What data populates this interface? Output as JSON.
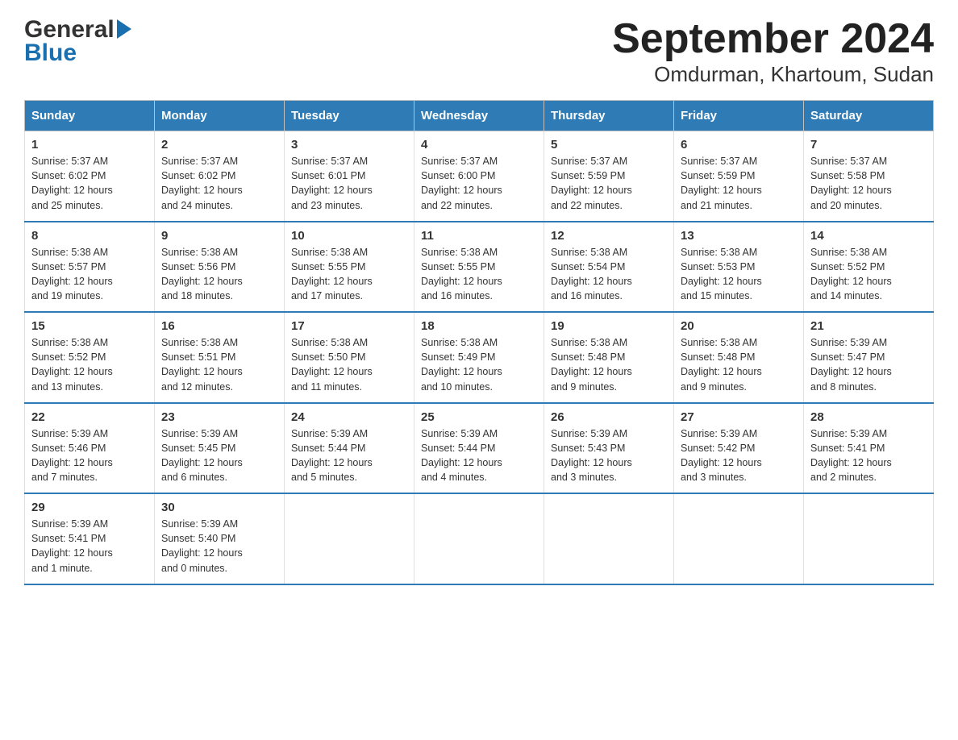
{
  "logo": {
    "part1": "General",
    "part2": "Blue"
  },
  "title": {
    "month_year": "September 2024",
    "location": "Omdurman, Khartoum, Sudan"
  },
  "days_of_week": [
    "Sunday",
    "Monday",
    "Tuesday",
    "Wednesday",
    "Thursday",
    "Friday",
    "Saturday"
  ],
  "weeks": [
    [
      {
        "day": "1",
        "sunrise": "5:37 AM",
        "sunset": "6:02 PM",
        "daylight": "12 hours and 25 minutes."
      },
      {
        "day": "2",
        "sunrise": "5:37 AM",
        "sunset": "6:02 PM",
        "daylight": "12 hours and 24 minutes."
      },
      {
        "day": "3",
        "sunrise": "5:37 AM",
        "sunset": "6:01 PM",
        "daylight": "12 hours and 23 minutes."
      },
      {
        "day": "4",
        "sunrise": "5:37 AM",
        "sunset": "6:00 PM",
        "daylight": "12 hours and 22 minutes."
      },
      {
        "day": "5",
        "sunrise": "5:37 AM",
        "sunset": "5:59 PM",
        "daylight": "12 hours and 22 minutes."
      },
      {
        "day": "6",
        "sunrise": "5:37 AM",
        "sunset": "5:59 PM",
        "daylight": "12 hours and 21 minutes."
      },
      {
        "day": "7",
        "sunrise": "5:37 AM",
        "sunset": "5:58 PM",
        "daylight": "12 hours and 20 minutes."
      }
    ],
    [
      {
        "day": "8",
        "sunrise": "5:38 AM",
        "sunset": "5:57 PM",
        "daylight": "12 hours and 19 minutes."
      },
      {
        "day": "9",
        "sunrise": "5:38 AM",
        "sunset": "5:56 PM",
        "daylight": "12 hours and 18 minutes."
      },
      {
        "day": "10",
        "sunrise": "5:38 AM",
        "sunset": "5:55 PM",
        "daylight": "12 hours and 17 minutes."
      },
      {
        "day": "11",
        "sunrise": "5:38 AM",
        "sunset": "5:55 PM",
        "daylight": "12 hours and 16 minutes."
      },
      {
        "day": "12",
        "sunrise": "5:38 AM",
        "sunset": "5:54 PM",
        "daylight": "12 hours and 16 minutes."
      },
      {
        "day": "13",
        "sunrise": "5:38 AM",
        "sunset": "5:53 PM",
        "daylight": "12 hours and 15 minutes."
      },
      {
        "day": "14",
        "sunrise": "5:38 AM",
        "sunset": "5:52 PM",
        "daylight": "12 hours and 14 minutes."
      }
    ],
    [
      {
        "day": "15",
        "sunrise": "5:38 AM",
        "sunset": "5:52 PM",
        "daylight": "12 hours and 13 minutes."
      },
      {
        "day": "16",
        "sunrise": "5:38 AM",
        "sunset": "5:51 PM",
        "daylight": "12 hours and 12 minutes."
      },
      {
        "day": "17",
        "sunrise": "5:38 AM",
        "sunset": "5:50 PM",
        "daylight": "12 hours and 11 minutes."
      },
      {
        "day": "18",
        "sunrise": "5:38 AM",
        "sunset": "5:49 PM",
        "daylight": "12 hours and 10 minutes."
      },
      {
        "day": "19",
        "sunrise": "5:38 AM",
        "sunset": "5:48 PM",
        "daylight": "12 hours and 9 minutes."
      },
      {
        "day": "20",
        "sunrise": "5:38 AM",
        "sunset": "5:48 PM",
        "daylight": "12 hours and 9 minutes."
      },
      {
        "day": "21",
        "sunrise": "5:39 AM",
        "sunset": "5:47 PM",
        "daylight": "12 hours and 8 minutes."
      }
    ],
    [
      {
        "day": "22",
        "sunrise": "5:39 AM",
        "sunset": "5:46 PM",
        "daylight": "12 hours and 7 minutes."
      },
      {
        "day": "23",
        "sunrise": "5:39 AM",
        "sunset": "5:45 PM",
        "daylight": "12 hours and 6 minutes."
      },
      {
        "day": "24",
        "sunrise": "5:39 AM",
        "sunset": "5:44 PM",
        "daylight": "12 hours and 5 minutes."
      },
      {
        "day": "25",
        "sunrise": "5:39 AM",
        "sunset": "5:44 PM",
        "daylight": "12 hours and 4 minutes."
      },
      {
        "day": "26",
        "sunrise": "5:39 AM",
        "sunset": "5:43 PM",
        "daylight": "12 hours and 3 minutes."
      },
      {
        "day": "27",
        "sunrise": "5:39 AM",
        "sunset": "5:42 PM",
        "daylight": "12 hours and 3 minutes."
      },
      {
        "day": "28",
        "sunrise": "5:39 AM",
        "sunset": "5:41 PM",
        "daylight": "12 hours and 2 minutes."
      }
    ],
    [
      {
        "day": "29",
        "sunrise": "5:39 AM",
        "sunset": "5:41 PM",
        "daylight": "12 hours and 1 minute."
      },
      {
        "day": "30",
        "sunrise": "5:39 AM",
        "sunset": "5:40 PM",
        "daylight": "12 hours and 0 minutes."
      },
      null,
      null,
      null,
      null,
      null
    ]
  ],
  "labels": {
    "sunrise": "Sunrise:",
    "sunset": "Sunset:",
    "daylight": "Daylight:"
  }
}
